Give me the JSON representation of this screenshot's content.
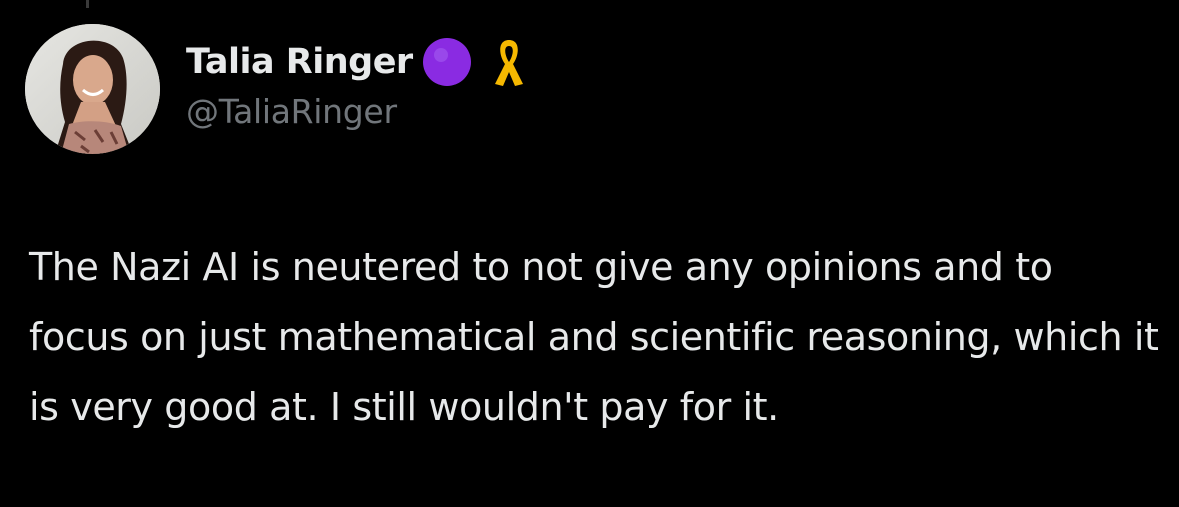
{
  "author": {
    "display_name": "Talia Ringer",
    "handle": "@TaliaRinger",
    "badges": [
      {
        "icon": "purple-circle-icon",
        "color": "#8a2be2"
      },
      {
        "icon": "yellow-ribbon-icon",
        "color": "#f5b800"
      }
    ]
  },
  "tweet": {
    "text": "The Nazi AI is neutered to not give any opinions and to focus on just mathematical and scientific reasoning, which it is very good at. I still wouldn't pay for it."
  },
  "theme": {
    "background": "#000000",
    "text_color": "#e7e9ea",
    "secondary_text_color": "#71767b"
  }
}
